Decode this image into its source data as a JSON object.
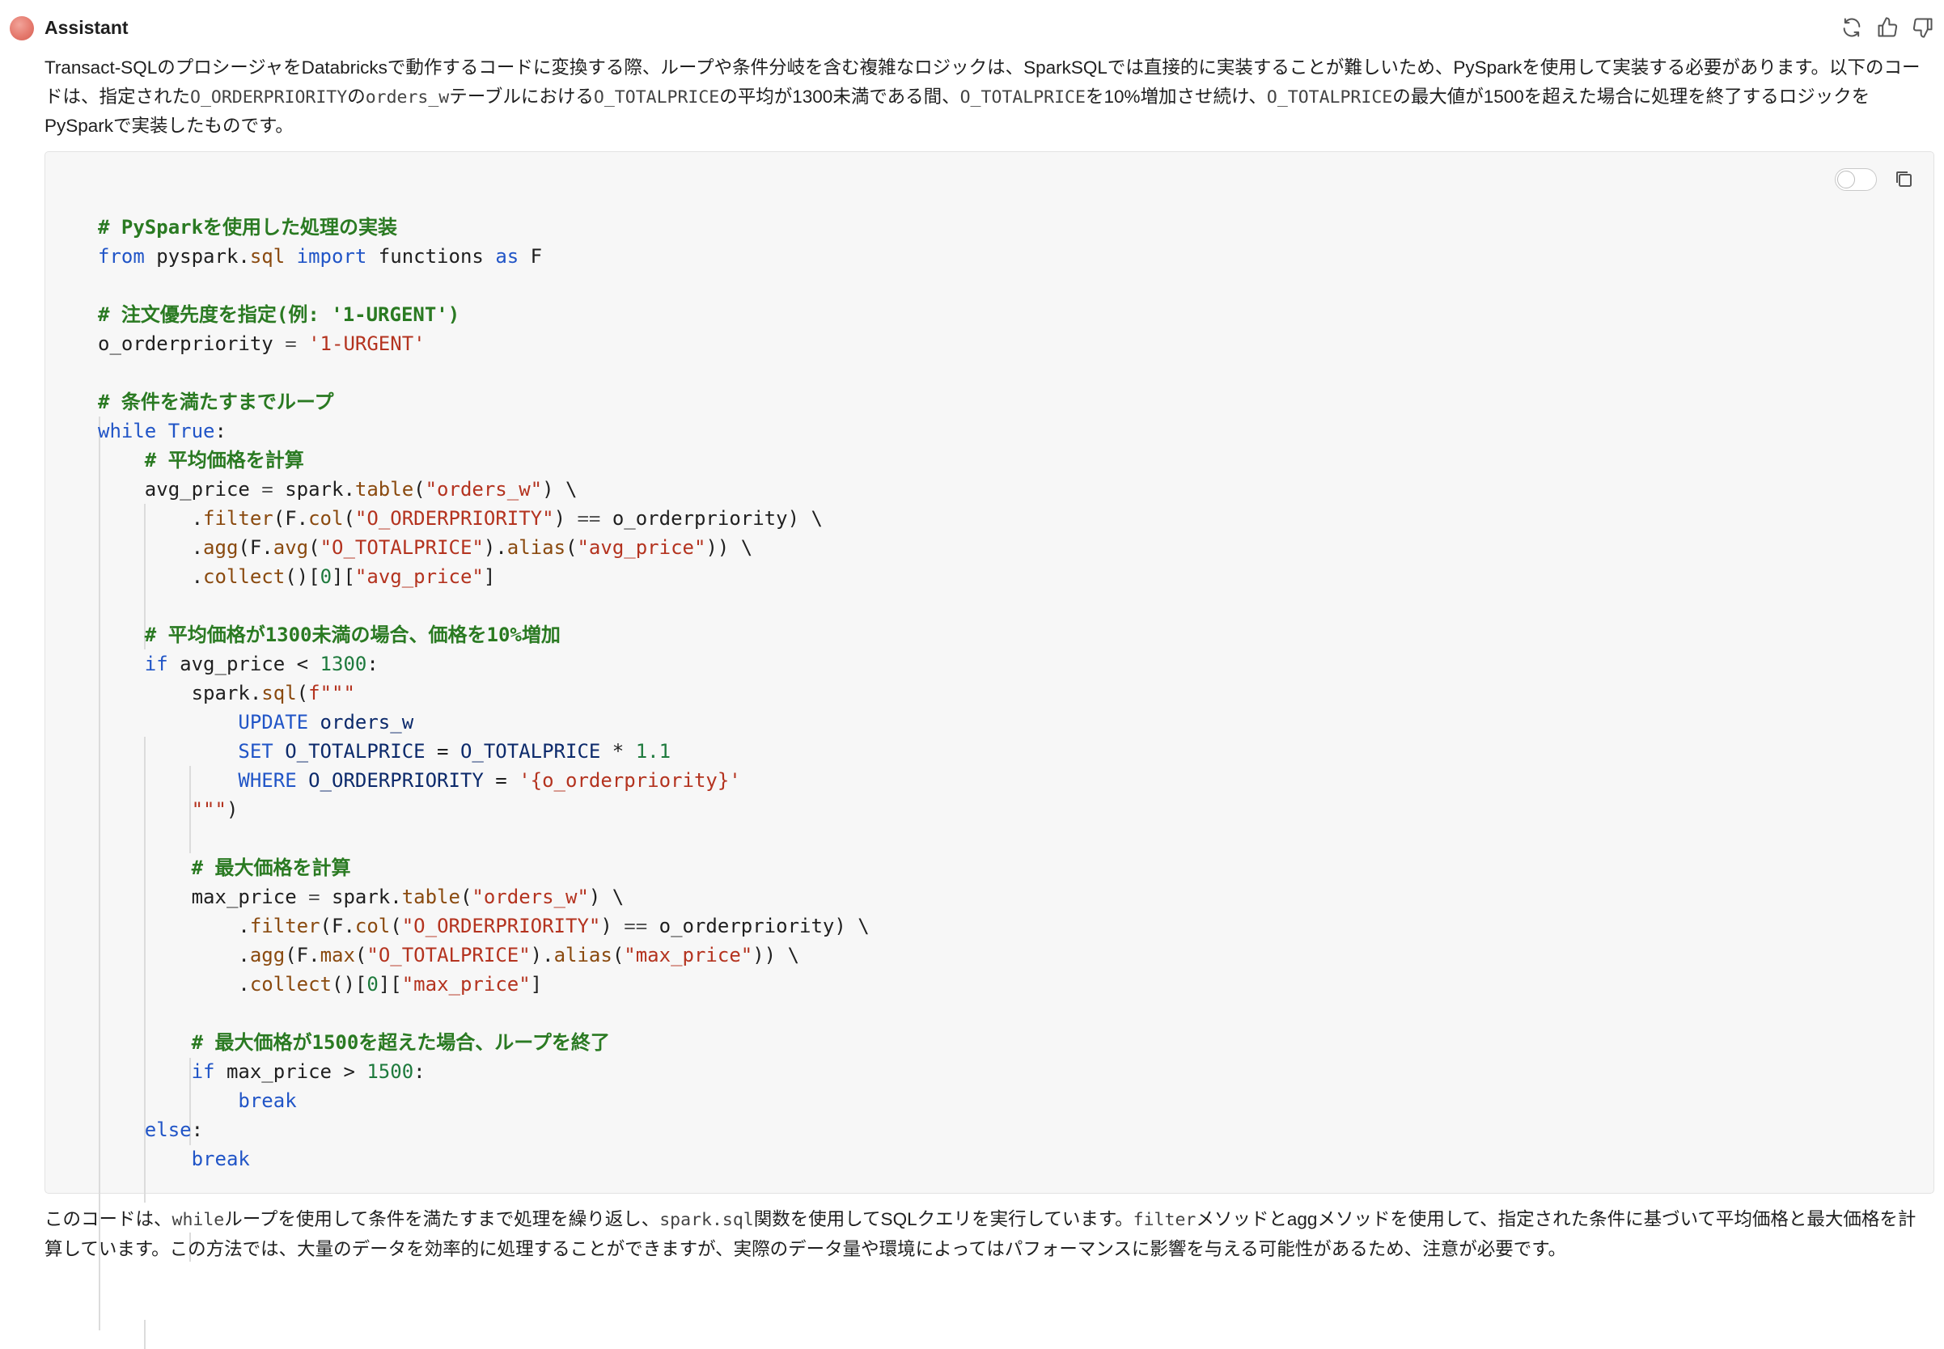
{
  "message": {
    "author": "Assistant",
    "intro_text": "Transact-SQLのプロシージャをDatabricksで動作するコードに変換する際、ループや条件分岐を含む複雑なロジックは、SparkSQLでは直接的に実装することが難しいため、PySparkを使用して実装する必要があります。以下のコードは、指定されたO_ORDERPRIORITYのorders_wテーブルにおけるO_TOTALPRICEの平均が1300未満である間、O_TOTALPRICEを10%増加させ続け、O_TOTALPRICEの最大値が1500を超えた場合に処理を終了するロジックをPySparkで実装したものです。",
    "outro_text": "このコードは、whileループを使用して条件を満たすまで処理を繰り返し、spark.sql関数を使用してSQLクエリを実行しています。filterメソッドとaggメソッドを使用して、指定された条件に基づいて平均価格と最大価格を計算しています。この方法では、大量のデータを効率的に処理することができますが、実際のデータ量や環境によってはパフォーマンスに影響を与える可能性があるため、注意が必要です。"
  },
  "actions": {
    "regenerate_icon": "refresh-icon",
    "like_icon": "thumbs-up-icon",
    "dislike_icon": "thumbs-down-icon"
  },
  "code_block": {
    "language": "python",
    "wrap_toggle_icon": "toggle-icon",
    "copy_icon": "copy-icon",
    "lines": [
      "# PySparkを使用した処理の実装",
      "from pyspark.sql import functions as F",
      "",
      "# 注文優先度を指定(例: '1-URGENT')",
      "o_orderpriority = '1-URGENT'",
      "",
      "# 条件を満たすまでループ",
      "while True:",
      "    # 平均価格を計算",
      "    avg_price = spark.table(\"orders_w\") \\",
      "        .filter(F.col(\"O_ORDERPRIORITY\") == o_orderpriority) \\",
      "        .agg(F.avg(\"O_TOTALPRICE\").alias(\"avg_price\")) \\",
      "        .collect()[0][\"avg_price\"]",
      "",
      "    # 平均価格が1300未満の場合、価格を10%増加",
      "    if avg_price < 1300:",
      "        spark.sql(f\"\"\"",
      "            UPDATE orders_w",
      "            SET O_TOTALPRICE = O_TOTALPRICE * 1.1",
      "            WHERE O_ORDERPRIORITY = '{o_orderpriority}'",
      "        \"\"\")",
      "",
      "        # 最大価格を計算",
      "        max_price = spark.table(\"orders_w\") \\",
      "            .filter(F.col(\"O_ORDERPRIORITY\") == o_orderpriority) \\",
      "            .agg(F.max(\"O_TOTALPRICE\").alias(\"max_price\")) \\",
      "            .collect()[0][\"max_price\"]",
      "",
      "        # 最大価格が1500を超えた場合、ループを終了",
      "        if max_price > 1500:",
      "            break",
      "    else:",
      "        break"
    ]
  },
  "colors": {
    "keyword": "#2155c7",
    "comment": "#2a7a22",
    "string": "#b4331f",
    "number": "#1e7a3d",
    "code_background": "#f7f7f7"
  }
}
